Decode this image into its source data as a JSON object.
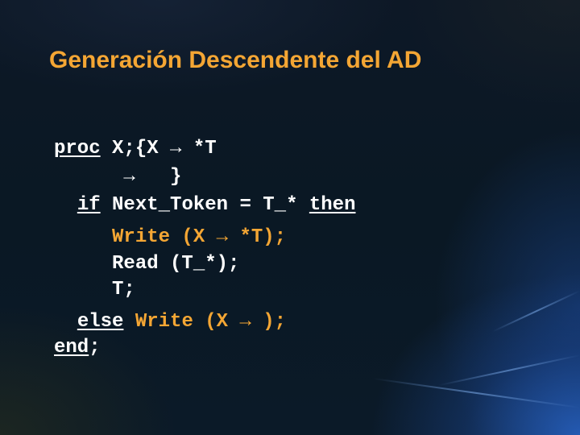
{
  "slide": {
    "title": "Generación Descendente del AD",
    "colors": {
      "title": "#f4a634",
      "code_default": "#ffffff",
      "code_highlight": "#f4a634",
      "background": "#0b1825"
    }
  },
  "code": {
    "line1": {
      "kw": "proc",
      "rest": " X;{X → *T"
    },
    "line2": {
      "text": "      →   }"
    },
    "line3": {
      "indent": "  ",
      "kw_if": "if",
      "mid": " Next_Token = T_* ",
      "kw_then": "then"
    },
    "line4": {
      "indent": "     ",
      "text": "Write (X → *T);"
    },
    "line5": {
      "indent": "     ",
      "text": "Read (T_*);"
    },
    "line6": {
      "indent": "     ",
      "text": "T;"
    },
    "line7": {
      "indent": "  ",
      "kw_else": "else",
      "sp": " ",
      "text": "Write (X → );"
    },
    "line8": {
      "kw_end": "end",
      "rest": ";"
    }
  }
}
